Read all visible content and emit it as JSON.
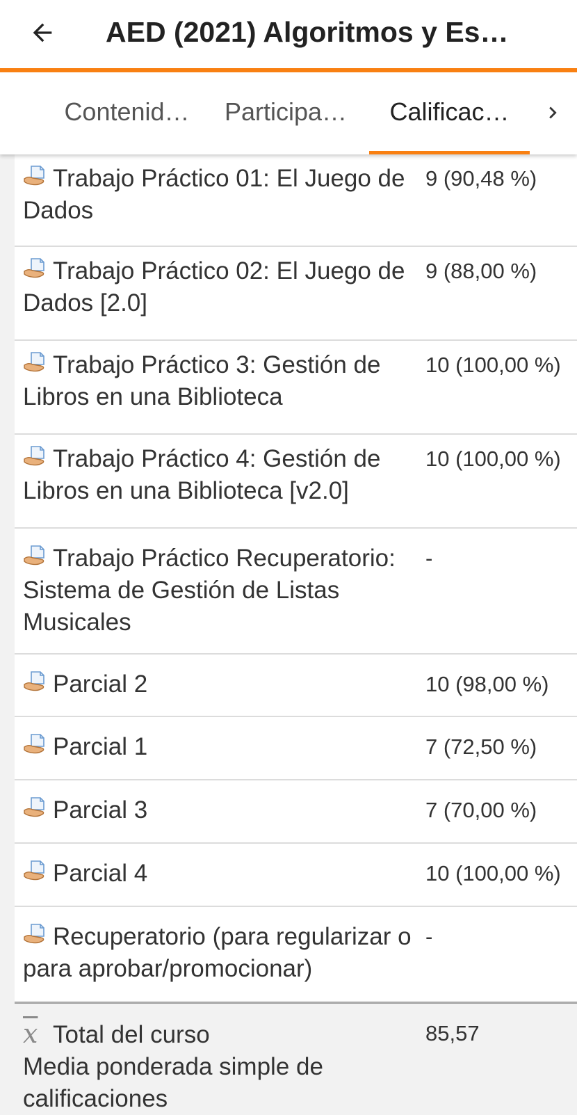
{
  "header": {
    "back_icon": "arrow-left-icon",
    "title": "AED (2021) Algoritmos y Es…"
  },
  "colors": {
    "accent": "#f98012",
    "background": "#f2f2f2",
    "surface": "#ffffff"
  },
  "tabs": [
    {
      "label": "Contenid…",
      "active": false
    },
    {
      "label": "Participa…",
      "active": false
    },
    {
      "label": "Calificac…",
      "active": true
    }
  ],
  "tabs_next_icon": "chevron-right-icon",
  "grades": {
    "item_icon": "assignment-hand-icon",
    "items": [
      {
        "name": "Trabajo Práctico 01: El Juego de Dados",
        "grade": "9 (90,48 %)"
      },
      {
        "name": "Trabajo Práctico 02: El Juego de Dados [2.0]",
        "grade": "9 (88,00 %)"
      },
      {
        "name": "Trabajo Práctico 3: Gestión de Libros en una Biblioteca",
        "grade": "10 (100,00 %)"
      },
      {
        "name": "Trabajo Práctico 4: Gestión de Libros en una Biblioteca [v2.0]",
        "grade": "10 (100,00 %)"
      },
      {
        "name": "Trabajo Práctico Recuperatorio: Sistema de Gestión de Listas Musicales",
        "grade": "-"
      },
      {
        "name": "Parcial 2",
        "grade": "10 (98,00 %)"
      },
      {
        "name": "Parcial 1",
        "grade": "7 (72,50 %)"
      },
      {
        "name": "Parcial 3",
        "grade": "7 (70,00 %)"
      },
      {
        "name": "Parcial 4",
        "grade": "10 (100,00 %)"
      },
      {
        "name": "Recuperatorio (para regularizar o para aprobar/promocionar)",
        "grade": "-"
      }
    ],
    "total": {
      "icon": "mean-icon",
      "label": "Total del curso",
      "subtitle": "Media ponderada simple de calificaciones",
      "grade": "85,57"
    }
  }
}
